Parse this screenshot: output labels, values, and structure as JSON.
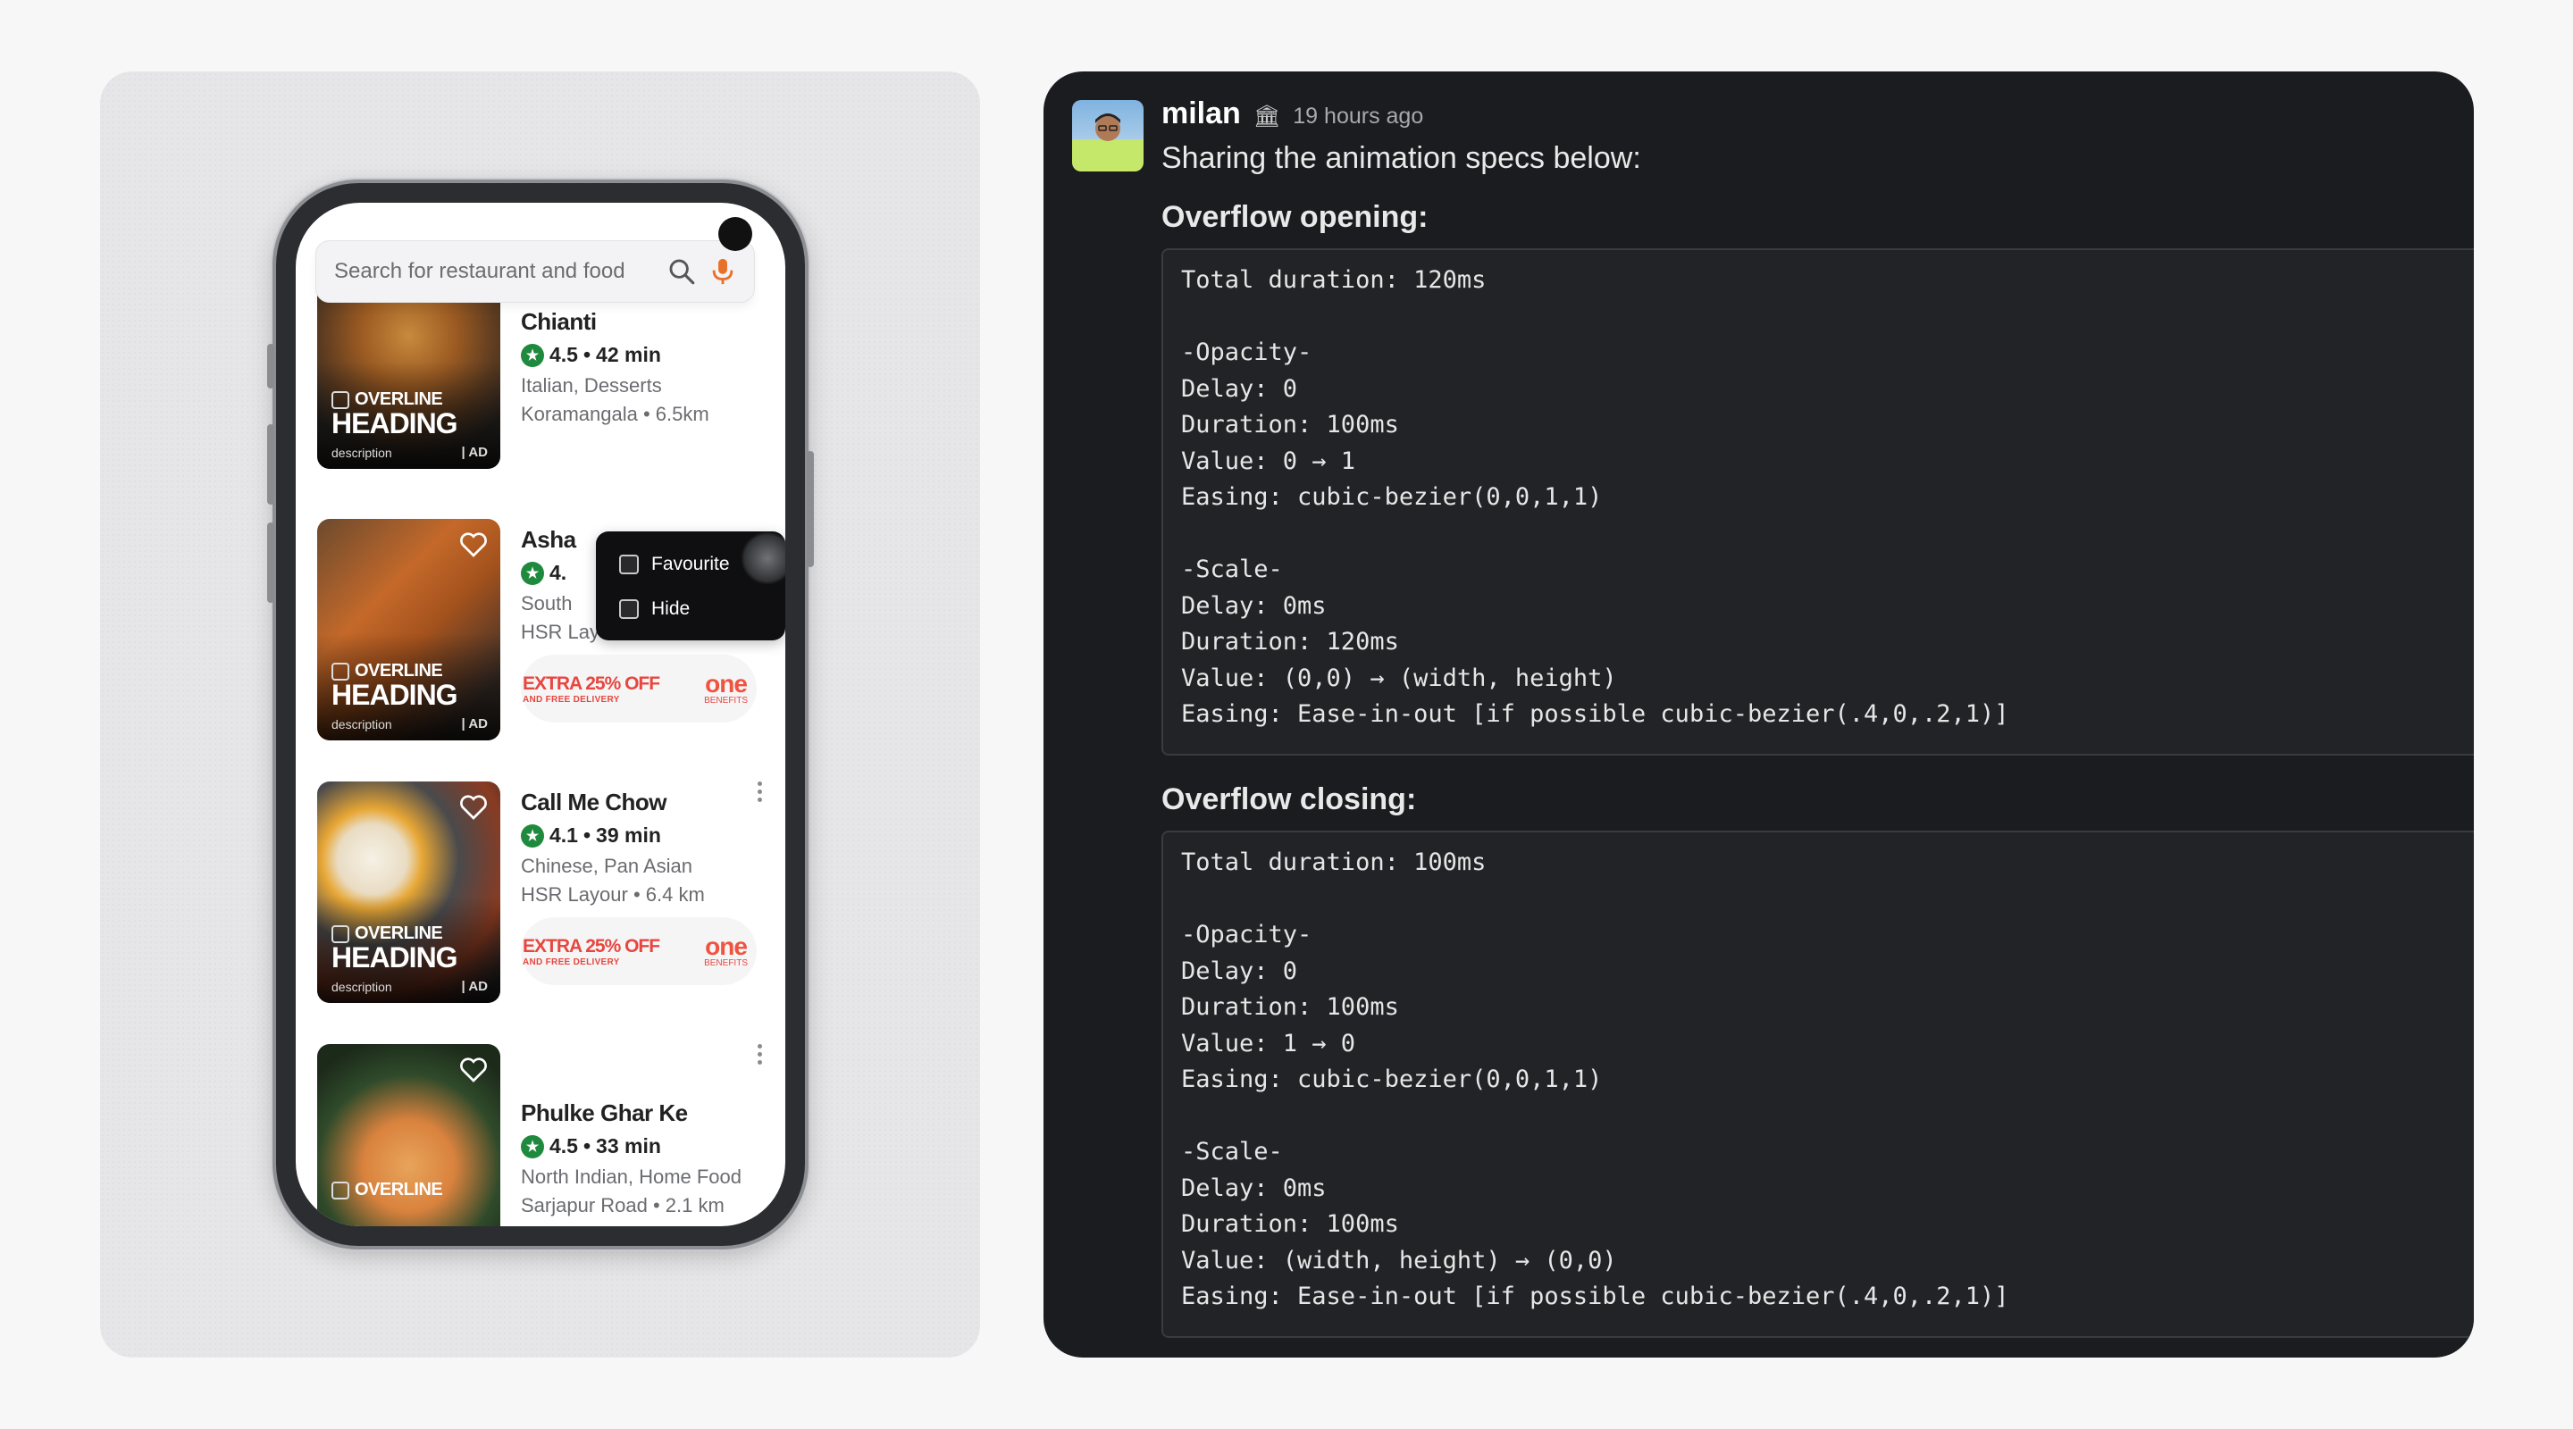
{
  "phone": {
    "search_placeholder": "Search for restaurant and food",
    "restaurants": [
      {
        "name": "Chianti",
        "rating": "4.5",
        "time": "42 min",
        "cuisine": "Italian, Desserts",
        "location": "Koramangala • 6.5km",
        "offer": false
      },
      {
        "name": "Asha",
        "rating": "4.",
        "time": "",
        "cuisine": "South",
        "location": "HSR Layout • 5.1 km",
        "offer": true
      },
      {
        "name": "Call Me Chow",
        "rating": "4.1",
        "time": "39 min",
        "cuisine": "Chinese, Pan Asian",
        "location": "HSR Layour • 6.4 km",
        "offer": true
      },
      {
        "name": "Phulke Ghar Ke",
        "rating": "4.5",
        "time": "33 min",
        "cuisine": "North Indian, Home Food",
        "location": "Sarjapur Road • 2.1 km",
        "offer": false
      }
    ],
    "ad": {
      "overline": "OVERLINE",
      "heading": "HEADING",
      "description": "description",
      "ad_label": "AD"
    },
    "offer": {
      "title": "EXTRA 25% OFF",
      "subtitle": "AND FREE DELIVERY",
      "brand": "one",
      "brand_sub": "BENEFITS"
    },
    "overflow_menu": [
      "Favourite",
      "Hide"
    ],
    "colors": {
      "rating_green": "#1f8a3e",
      "offer_red": "#e8463f",
      "mic_orange": "#e8712a"
    }
  },
  "message": {
    "username": "milan",
    "timestamp": "19 hours ago",
    "text": "Sharing the animation specs below:",
    "sections": [
      {
        "title": "Overflow opening:",
        "code": "Total duration: 120ms\n\n-Opacity-\nDelay: 0\nDuration: 100ms\nValue: 0 → 1\nEasing: cubic-bezier(0,0,1,1)\n\n-Scale-\nDelay: 0ms\nDuration: 120ms\nValue: (0,0) → (width, height)\nEasing: Ease-in-out [if possible cubic-bezier(.4,0,.2,1)]"
      },
      {
        "title": "Overflow closing:",
        "code": "Total duration: 100ms\n\n-Opacity-\nDelay: 0\nDuration: 100ms\nValue: 1 → 0\nEasing: cubic-bezier(0,0,1,1)\n\n-Scale-\nDelay: 0ms\nDuration: 100ms\nValue: (width, height) → (0,0)\nEasing: Ease-in-out [if possible cubic-bezier(.4,0,.2,1)]"
      }
    ]
  }
}
